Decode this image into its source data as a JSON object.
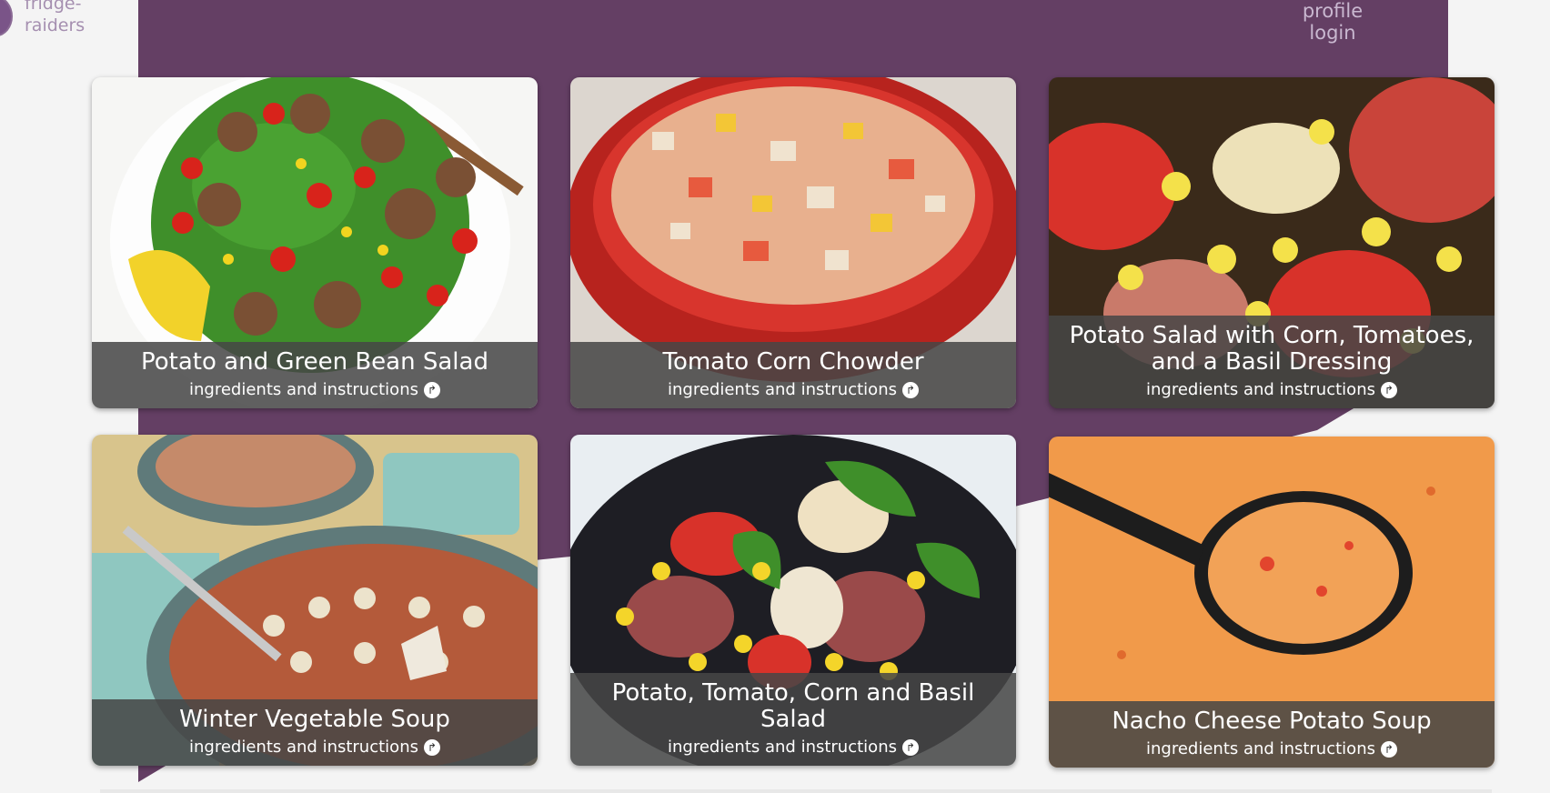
{
  "brand": {
    "line1": "fridge-",
    "line2": "raiders"
  },
  "nav": {
    "profile": "profile",
    "login": "login"
  },
  "recipes": [
    {
      "title": "Potato and Green Bean Salad",
      "link": "ingredients and instructions"
    },
    {
      "title": "Tomato Corn Chowder",
      "link": "ingredients and instructions"
    },
    {
      "title": "Potato Salad with Corn, Tomatoes, and a Basil Dressing",
      "link": "ingredients and instructions"
    },
    {
      "title": "Winter Vegetable Soup",
      "link": "ingredients and instructions"
    },
    {
      "title": "Potato, Tomato, Corn and Basil Salad",
      "link": "ingredients and instructions"
    },
    {
      "title": "Nacho Cheese Potato Soup",
      "link": "ingredients and instructions"
    }
  ],
  "colors": {
    "primary": "#643f64",
    "background": "#f4f4f4",
    "caption": "#464646"
  }
}
